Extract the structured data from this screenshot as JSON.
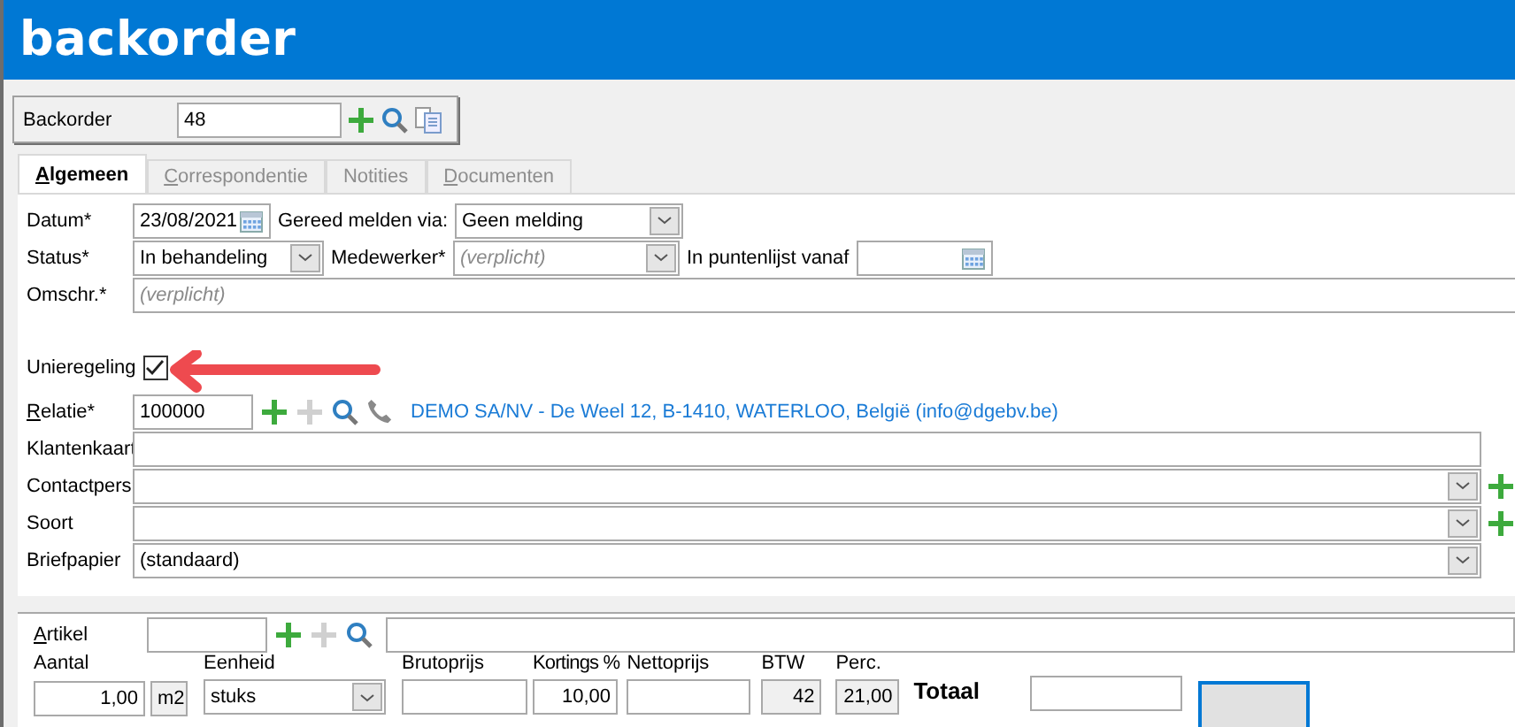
{
  "window": {
    "title": "backorder"
  },
  "toolbar": {
    "label": "Backorder",
    "value": "48"
  },
  "tabs": [
    {
      "label": "Algemeen",
      "selected": true,
      "access_key": true
    },
    {
      "label": "Correspondentie",
      "selected": false,
      "access_key": true
    },
    {
      "label": "Notities",
      "selected": false,
      "access_key": false
    },
    {
      "label": "Documenten",
      "selected": false,
      "access_key": true
    }
  ],
  "header": {
    "datum": {
      "label": "Datum*",
      "value": "23/08/2021"
    },
    "gereed": {
      "label": "Gereed melden via:",
      "value": "Geen melding"
    },
    "status": {
      "label": "Status*",
      "value": "In behandeling"
    },
    "medewerker": {
      "label": "Medewerker*",
      "placeholder": "(verplicht)"
    },
    "puntenlijst": {
      "label": "In puntenlijst vanaf"
    },
    "omschrijving": {
      "label": "Omschr.*",
      "placeholder": "(verplicht)"
    }
  },
  "unieregeling": {
    "label": "Unieregeling",
    "checked": true
  },
  "relatie": {
    "label": "Relatie*",
    "access_key": true,
    "value": "100000",
    "info": "DEMO SA/NV - De Weel 12, B-1410, WATERLOO, België (info@dgebv.be)"
  },
  "lines": [
    {
      "label": "Klantenkaart",
      "kind": "text",
      "add": false
    },
    {
      "label": "Contactpers",
      "kind": "combo",
      "add": true
    },
    {
      "label": "Soort",
      "kind": "combo",
      "add": true
    },
    {
      "label": "Briefpapier",
      "kind": "combo",
      "add": false,
      "value": "(standaard)"
    }
  ],
  "artikel": {
    "label": "Artikel",
    "access_key": true
  },
  "item": {
    "aantal": {
      "label": "Aantal",
      "value": "1,00",
      "unit": "m2"
    },
    "eenheid": {
      "label": "Eenheid",
      "value": "stuks"
    },
    "brutoprijs": {
      "label": "Brutoprijs"
    },
    "korting": {
      "label": "Kortings %",
      "value": "10,00"
    },
    "nettoprijs": {
      "label": "Nettoprijs"
    },
    "btw": {
      "label": "BTW",
      "value": "42"
    },
    "perc": {
      "label": "Perc.",
      "value": "21,00"
    },
    "totaal": {
      "label": "Totaal"
    }
  }
}
